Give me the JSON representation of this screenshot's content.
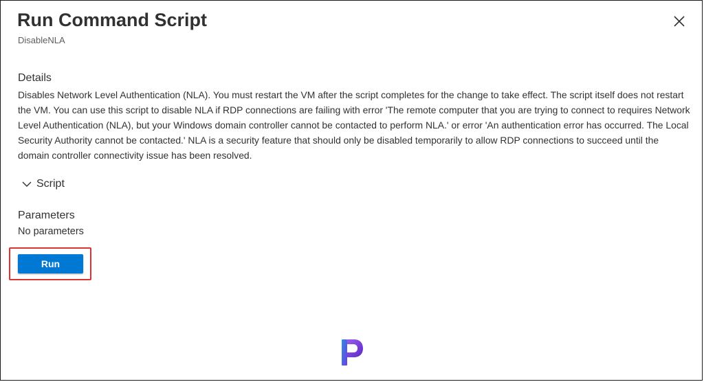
{
  "panel": {
    "title": "Run Command Script",
    "subtitle": "DisableNLA",
    "close_label": "Close",
    "close_icon": "close-icon"
  },
  "details": {
    "heading": "Details",
    "text": "Disables Network Level Authentication (NLA). You must restart the VM after the script completes for the change to take effect. The script itself does not restart the VM. You can use this script to disable NLA if RDP connections are failing with error 'The remote computer that you are trying to connect to requires Network Level Authentication (NLA), but your Windows domain controller cannot be contacted to perform NLA.' or error 'An authentication error has occurred. The Local Security Authority cannot be contacted.' NLA is a security feature that should only be disabled temporarily to allow RDP connections to succeed until the domain controller connectivity issue has been resolved."
  },
  "script_section": {
    "label": "Script",
    "icon": "chevron-down-icon",
    "expanded": false
  },
  "parameters": {
    "heading": "Parameters",
    "value": "No parameters"
  },
  "actions": {
    "run_label": "Run"
  },
  "colors": {
    "accent": "#0078d4",
    "highlight": "#e03131",
    "text": "#323130",
    "secondary_text": "#605e5c"
  },
  "watermark": {
    "icon": "brand-logo-icon",
    "letter": "P"
  }
}
